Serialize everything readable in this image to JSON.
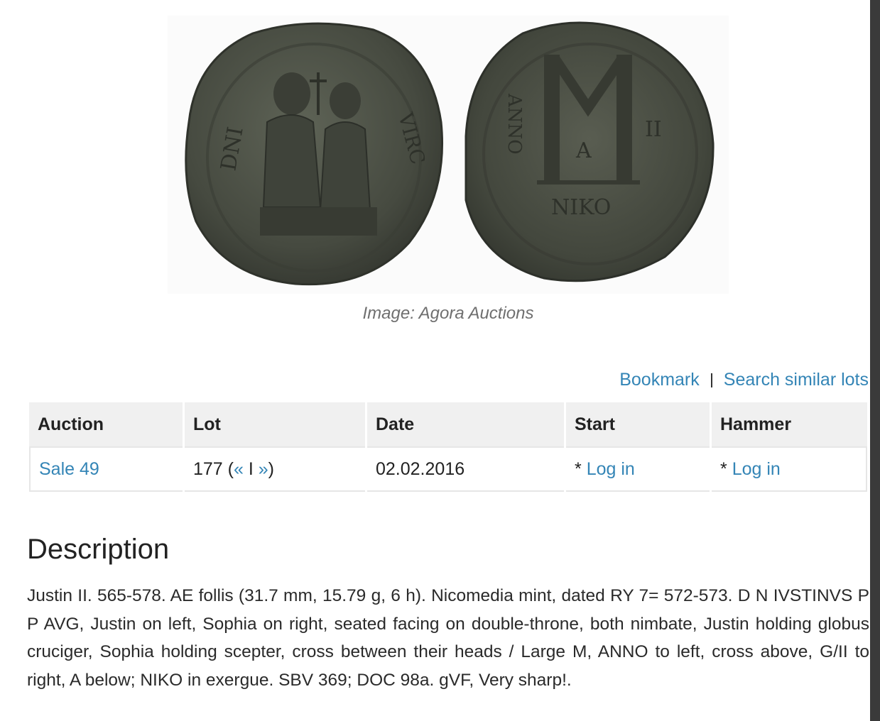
{
  "image": {
    "caption": "Image: Agora Auctions"
  },
  "actions": {
    "bookmark": "Bookmark",
    "search_similar": "Search similar lots"
  },
  "table": {
    "headers": [
      "Auction",
      "Lot",
      "Date",
      "Start",
      "Hammer"
    ],
    "row": {
      "auction": "Sale 49",
      "lot_number": "177 (",
      "prev": "«",
      "lot_sep": " I ",
      "next": "»",
      "lot_close": ")",
      "date": "02.02.2016",
      "start_prefix": "* ",
      "start_link": "Log in",
      "hammer_prefix": "* ",
      "hammer_link": "Log in"
    }
  },
  "description": {
    "title": "Description",
    "text": "Justin II. 565-578. AE follis (31.7 mm, 15.79 g, 6 h). Nicomedia mint, dated RY 7= 572-573. D N IVSTINVS P P AVG, Justin on left, Sophia on right, seated facing on double-throne, both nimbate, Justin holding globus cruciger, Sophia holding scepter, cross between their heads / Large M, ANNO to left, cross above, G/II to right, A below; NIKO in exergue. SBV 369; DOC 98a. gVF, Very sharp!."
  },
  "colors": {
    "link": "#3485b6",
    "header_bg": "#f0f0f0",
    "coin_bronze": "#4a4e44"
  }
}
